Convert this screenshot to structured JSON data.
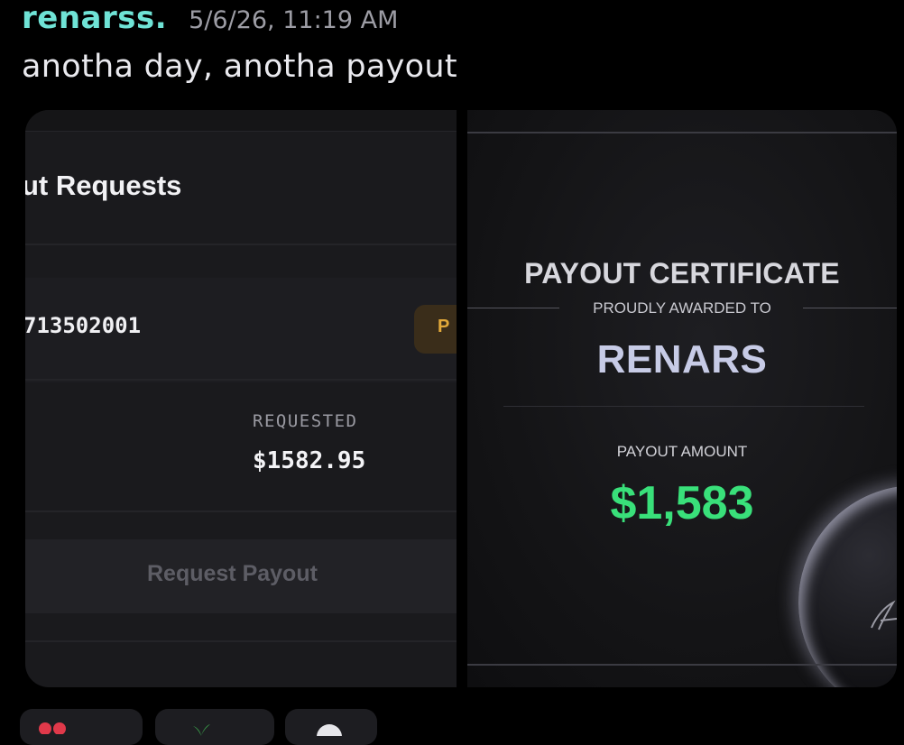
{
  "message": {
    "username": "renarss.",
    "timestamp": "5/6/26, 11:19 AM",
    "content": "anotha day, anotha payout"
  },
  "payout_requests": {
    "title": "ut Requests",
    "request_id": "713502001",
    "status_badge": "P",
    "requested_label": "REQUESTED",
    "requested_amount": "$1582.95",
    "request_button": "Request Payout"
  },
  "certificate": {
    "title": "PAYOUT CERTIFICATE",
    "awarded_label": "PROUDLY AWARDED TO",
    "recipient": "RENARS",
    "amount_label": "PAYOUT AMOUNT",
    "amount": "$1,583"
  },
  "reactions": [
    {
      "emoji_icon": "heart-eyes-icon"
    },
    {
      "emoji_icon": "plant-icon"
    },
    {
      "emoji_icon": "add-reaction-icon"
    }
  ],
  "colors": {
    "username": "#6fe3d6",
    "status_badge_text": "#e2a93a",
    "amount": "#39e07a",
    "recipient": "#c7cbe6"
  }
}
